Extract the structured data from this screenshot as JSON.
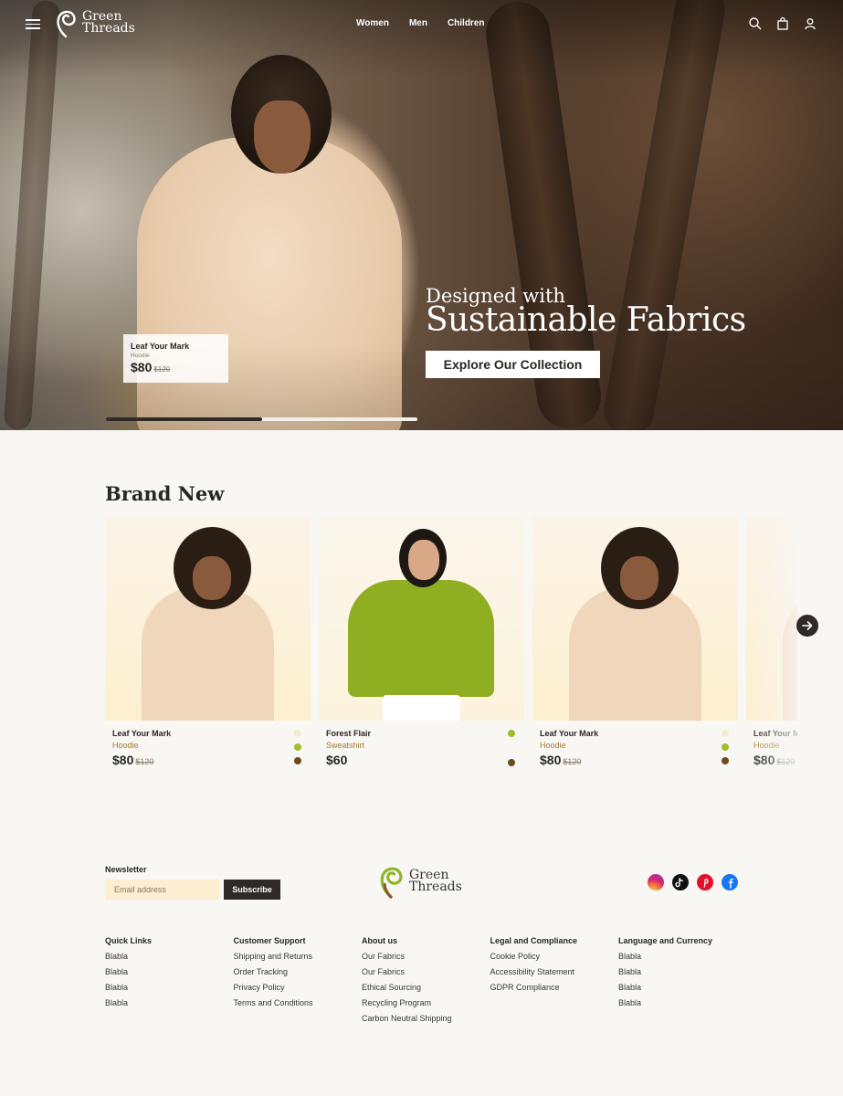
{
  "brand": {
    "line1": "Green",
    "line2": "Threads"
  },
  "nav": {
    "links": [
      "Women",
      "Men",
      "Children"
    ]
  },
  "icons": {
    "menu": "hamburger-menu-icon",
    "search": "search-icon",
    "bag": "shopping-bag-icon",
    "user": "user-icon",
    "next": "arrow-right-icon"
  },
  "hero": {
    "subtitle": "Designed with",
    "title": "Sustainable Fabrics",
    "cta": "Explore Our Collection",
    "tag": {
      "name": "Leaf Your Mark",
      "category": "Hoodie",
      "price": "$80",
      "old_price": "$120"
    },
    "slider_progress": 0.5
  },
  "brand_new": {
    "title": "Brand New",
    "products": [
      {
        "name": "Leaf Your Mark",
        "category": "Hoodie",
        "price": "$80",
        "old_price": "$120",
        "swatches": [
          "#f6ead2",
          "#9cbf2a",
          "#6e4b1e"
        ]
      },
      {
        "name": "Forest Flair",
        "category": "Sweatshirt",
        "price": "$60",
        "old_price": "",
        "swatches": [
          "#9cbf2a",
          "#6e4b1e"
        ]
      },
      {
        "name": "Leaf Your Mark",
        "category": "Hoodie",
        "price": "$80",
        "old_price": "$120",
        "swatches": [
          "#f6ead2",
          "#9cbf2a",
          "#6e4b1e"
        ]
      },
      {
        "name": "Leaf Your Mark",
        "category": "Hoodie",
        "price": "$80",
        "old_price": "$120",
        "swatches": []
      }
    ]
  },
  "footer": {
    "newsletter": {
      "label": "Newsletter",
      "placeholder": "Email address",
      "button": "Subscribe"
    },
    "socials": [
      "instagram-icon",
      "tiktok-icon",
      "pinterest-icon",
      "facebook-icon"
    ],
    "columns": [
      {
        "title": "Quick Links",
        "links": [
          "Blabla",
          "Blabla",
          "Blabla",
          "Blabla"
        ]
      },
      {
        "title": "Customer Support",
        "links": [
          "Shipping and Returns",
          "Order Tracking",
          "Privacy Policy",
          "Terms and Conditions"
        ]
      },
      {
        "title": "About us",
        "links": [
          "Our Fabrics",
          "Our Fabrics",
          "Ethical Sourcing",
          "Recycling Program",
          "Carbon Neutral Shipping"
        ]
      },
      {
        "title": "Legal and Compliance",
        "links": [
          "Cookie Policy",
          "Accessibility Statement",
          "GDPR Compliance"
        ]
      },
      {
        "title": "Language and Currency",
        "links": [
          "Blabla",
          "Blabla",
          "Blabla",
          "Blabla"
        ]
      }
    ]
  },
  "colors": {
    "dark": "#2f2a26",
    "accent_green": "#9cbf2a",
    "newsletter_bg": "#fdeed2"
  }
}
